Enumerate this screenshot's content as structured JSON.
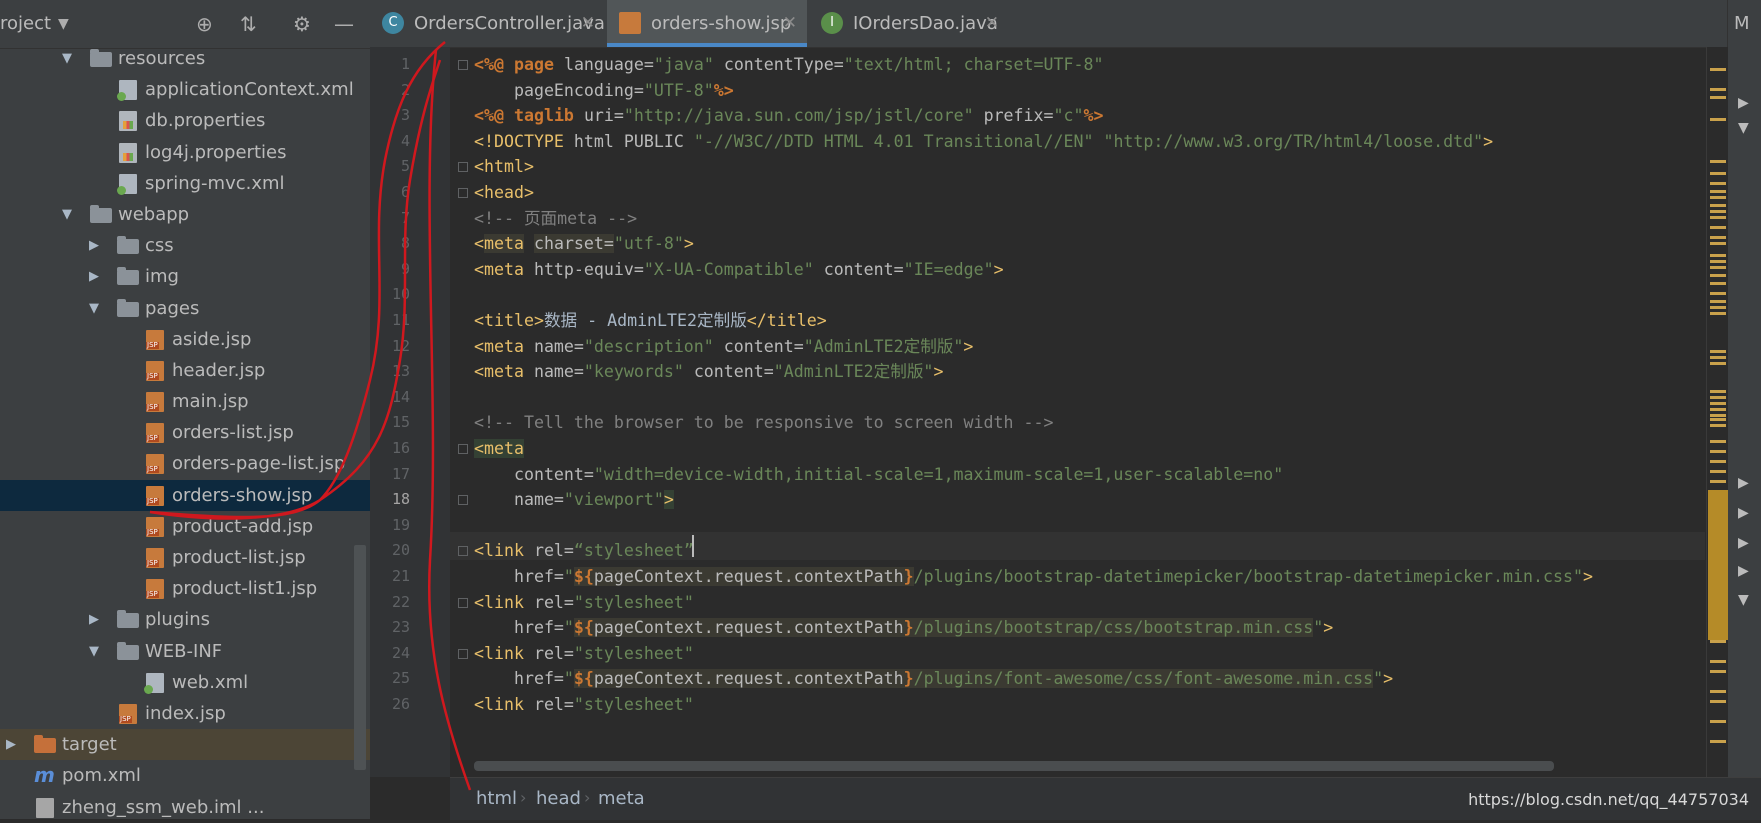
{
  "project_panel": {
    "title": "roject",
    "tree": [
      {
        "label": "resources",
        "type": "folder",
        "depth": 1,
        "expanded": true
      },
      {
        "label": "applicationContext.xml",
        "type": "xml",
        "depth": 2
      },
      {
        "label": "db.properties",
        "type": "prop",
        "depth": 2
      },
      {
        "label": "log4j.properties",
        "type": "prop",
        "depth": 2
      },
      {
        "label": "spring-mvc.xml",
        "type": "xml",
        "depth": 2
      },
      {
        "label": "webapp",
        "type": "folder",
        "depth": 1,
        "expanded": true
      },
      {
        "label": "css",
        "type": "folder",
        "depth": 2,
        "expanded": false
      },
      {
        "label": "img",
        "type": "folder",
        "depth": 2,
        "expanded": false
      },
      {
        "label": "pages",
        "type": "folder",
        "depth": 2,
        "expanded": true
      },
      {
        "label": "aside.jsp",
        "type": "jsp",
        "depth": 3
      },
      {
        "label": "header.jsp",
        "type": "jsp",
        "depth": 3
      },
      {
        "label": "main.jsp",
        "type": "jsp",
        "depth": 3
      },
      {
        "label": "orders-list.jsp",
        "type": "jsp",
        "depth": 3
      },
      {
        "label": "orders-page-list.jsp",
        "type": "jsp",
        "depth": 3
      },
      {
        "label": "orders-show.jsp",
        "type": "jsp",
        "depth": 3,
        "selected": true
      },
      {
        "label": "product-add.jsp",
        "type": "jsp",
        "depth": 3
      },
      {
        "label": "product-list.jsp",
        "type": "jsp",
        "depth": 3
      },
      {
        "label": "product-list1.jsp",
        "type": "jsp",
        "depth": 3
      },
      {
        "label": "plugins",
        "type": "folder",
        "depth": 2,
        "expanded": false
      },
      {
        "label": "WEB-INF",
        "type": "folder",
        "depth": 2,
        "expanded": true
      },
      {
        "label": "web.xml",
        "type": "xml",
        "depth": 3
      },
      {
        "label": "index.jsp",
        "type": "jsp",
        "depth": 2
      },
      {
        "label": "target",
        "type": "folder-orange",
        "depth": 0,
        "expanded": false,
        "highlight": true
      },
      {
        "label": "pom.xml",
        "type": "maven",
        "depth": 0
      },
      {
        "label": "zheng_ssm_web.iml ...",
        "type": "iml",
        "depth": 0
      }
    ]
  },
  "tabs": [
    {
      "label": "OrdersController.java",
      "icon": "class-icon",
      "active": false
    },
    {
      "label": "orders-show.jsp",
      "icon": "jsp-icon",
      "active": true
    },
    {
      "label": "IOrdersDao.java",
      "icon": "interface-icon",
      "active": false
    }
  ],
  "tab_overflow": "M",
  "current_line": 18,
  "code_lines": [
    {
      "n": 1,
      "html": "<span class='dr'>&lt;%@</span> <span class='dr'>page</span> <span class='at'>language=</span><span class='sv'>\"java\"</span> <span class='at'>contentType=</span><span class='sv'>\"text/html; charset=UTF-8\"</span>"
    },
    {
      "n": 2,
      "html": "    <span class='at'>pageEncoding=</span><span class='sv'>\"UTF-8\"</span><span class='dr'>%&gt;</span>"
    },
    {
      "n": 3,
      "html": "<span class='dr'>&lt;%@</span> <span class='dr'>taglib</span> <span class='at'>uri=</span><span class='sv'>\"http://java.sun.com/jsp/jstl/core\"</span> <span class='at'>prefix=</span><span class='sv'>\"c\"</span><span class='dr'>%&gt;</span>"
    },
    {
      "n": 4,
      "html": "<span class='tg'>&lt;!DOCTYPE</span> <span class='at'>html PUBLIC</span> <span class='sv'>\"-//W3C//DTD HTML 4.01 Transitional//EN\"</span> <span class='sv'>\"http://www.w3.org/TR/html4/loose.dtd\"</span><span class='tg'>&gt;</span>"
    },
    {
      "n": 5,
      "html": "<span class='tg'>&lt;html&gt;</span>"
    },
    {
      "n": 6,
      "html": "<span class='tg'>&lt;head&gt;</span>"
    },
    {
      "n": 7,
      "html": "<span class='cm'>&lt;!-- 页面meta --&gt;</span>"
    },
    {
      "n": 8,
      "html": "<span class='tg'>&lt;</span><span class='tg hlw'>meta</span> <span class='at hlw'>charset=</span><span class='sv'>\"utf-8\"</span><span class='tg'>&gt;</span>"
    },
    {
      "n": 9,
      "html": "<span class='tg'>&lt;meta</span> <span class='at'>http-equiv=</span><span class='sv'>\"X-UA-Compatible\"</span> <span class='at'>content=</span><span class='sv'>\"IE=edge\"</span><span class='tg'>&gt;</span>"
    },
    {
      "n": 10,
      "html": ""
    },
    {
      "n": 11,
      "html": "<span class='tg'>&lt;title&gt;</span>数据 - AdminLTE2定制版<span class='tg'>&lt;/title&gt;</span>"
    },
    {
      "n": 12,
      "html": "<span class='tg'>&lt;meta</span> <span class='at'>name=</span><span class='sv'>\"description\"</span> <span class='at'>content=</span><span class='sv'>\"AdminLTE2定制版\"</span><span class='tg'>&gt;</span>"
    },
    {
      "n": 13,
      "html": "<span class='tg'>&lt;meta</span> <span class='at'>name=</span><span class='sv'>\"keywords\"</span> <span class='at'>content=</span><span class='sv'>\"AdminLTE2定制版\"</span><span class='tg'>&gt;</span>"
    },
    {
      "n": 14,
      "html": ""
    },
    {
      "n": 15,
      "html": "<span class='cm'>&lt;!-- Tell the browser to be responsive to screen width --&gt;</span>"
    },
    {
      "n": 16,
      "html": "<span class='tg hlbg'>&lt;meta</span>"
    },
    {
      "n": 17,
      "html": "    <span class='at'>content=</span><span class='sv'>\"width=device-width,initial-scale=1,maximum-scale=1,user-scalable=no\"</span>"
    },
    {
      "n": 18,
      "html": "    <span class='at'>name=</span><span class='sv'>\"viewport\"</span><span class='tg hlbg'>&gt;</span>"
    },
    {
      "n": 19,
      "html": ""
    },
    {
      "n": 20,
      "html": "<span class='tg'>&lt;link</span> <span class='at'>rel=</span><span class='sv'>“stylesheet”</span>"
    },
    {
      "n": 21,
      "html": "    <span class='at'>href=</span><span class='sv'>\"</span><span class='hlw'><span class='dr'>${</span><span class='at'>pageContext.request.contextPath</span><span class='dr'>}</span></span><span class='sv'>/plugins/bootstrap-datetimepicker/bootstrap-datetimepicker.min.css</span><span class='sv'>\"</span><span class='tg'>&gt;</span>"
    },
    {
      "n": 22,
      "html": "<span class='tg'>&lt;link</span> <span class='at'>rel=</span><span class='sv'>\"stylesheet\"</span>"
    },
    {
      "n": 23,
      "html": "    <span class='at'>href=</span><span class='sv'>\"</span><span class='hlw'><span class='dr'>${</span><span class='at'>pageContext.request.contextPath</span><span class='dr'>}</span><span class='sv'>/plugins/bootstrap/css/bootstrap.min.css</span></span><span class='sv'>\"</span><span class='tg'>&gt;</span>"
    },
    {
      "n": 24,
      "html": "<span class='tg'>&lt;link</span> <span class='at'>rel=</span><span class='sv'>\"stylesheet\"</span>"
    },
    {
      "n": 25,
      "html": "    <span class='at'>href=</span><span class='sv'>\"</span><span class='hlw'><span class='dr'>${</span><span class='at'>pageContext.request.contextPath</span><span class='dr'>}</span><span class='sv'>/plugins/font-awesome/css/font-awesome.min.css</span></span><span class='sv'>\"</span><span class='tg'>&gt;</span>"
    },
    {
      "n": 26,
      "html": "<span class='tg'>&lt;link</span> <span class='at'>rel=</span><span class='sv'>\"stylesheet\"</span>"
    }
  ],
  "breadcrumb": [
    "html",
    "head",
    "meta"
  ],
  "watermark": "https://blog.csdn.net/qq_44757034",
  "colors": {
    "annotation": "#d0181e",
    "selection": "#0d293e",
    "tab_accent": "#4a88c7"
  }
}
